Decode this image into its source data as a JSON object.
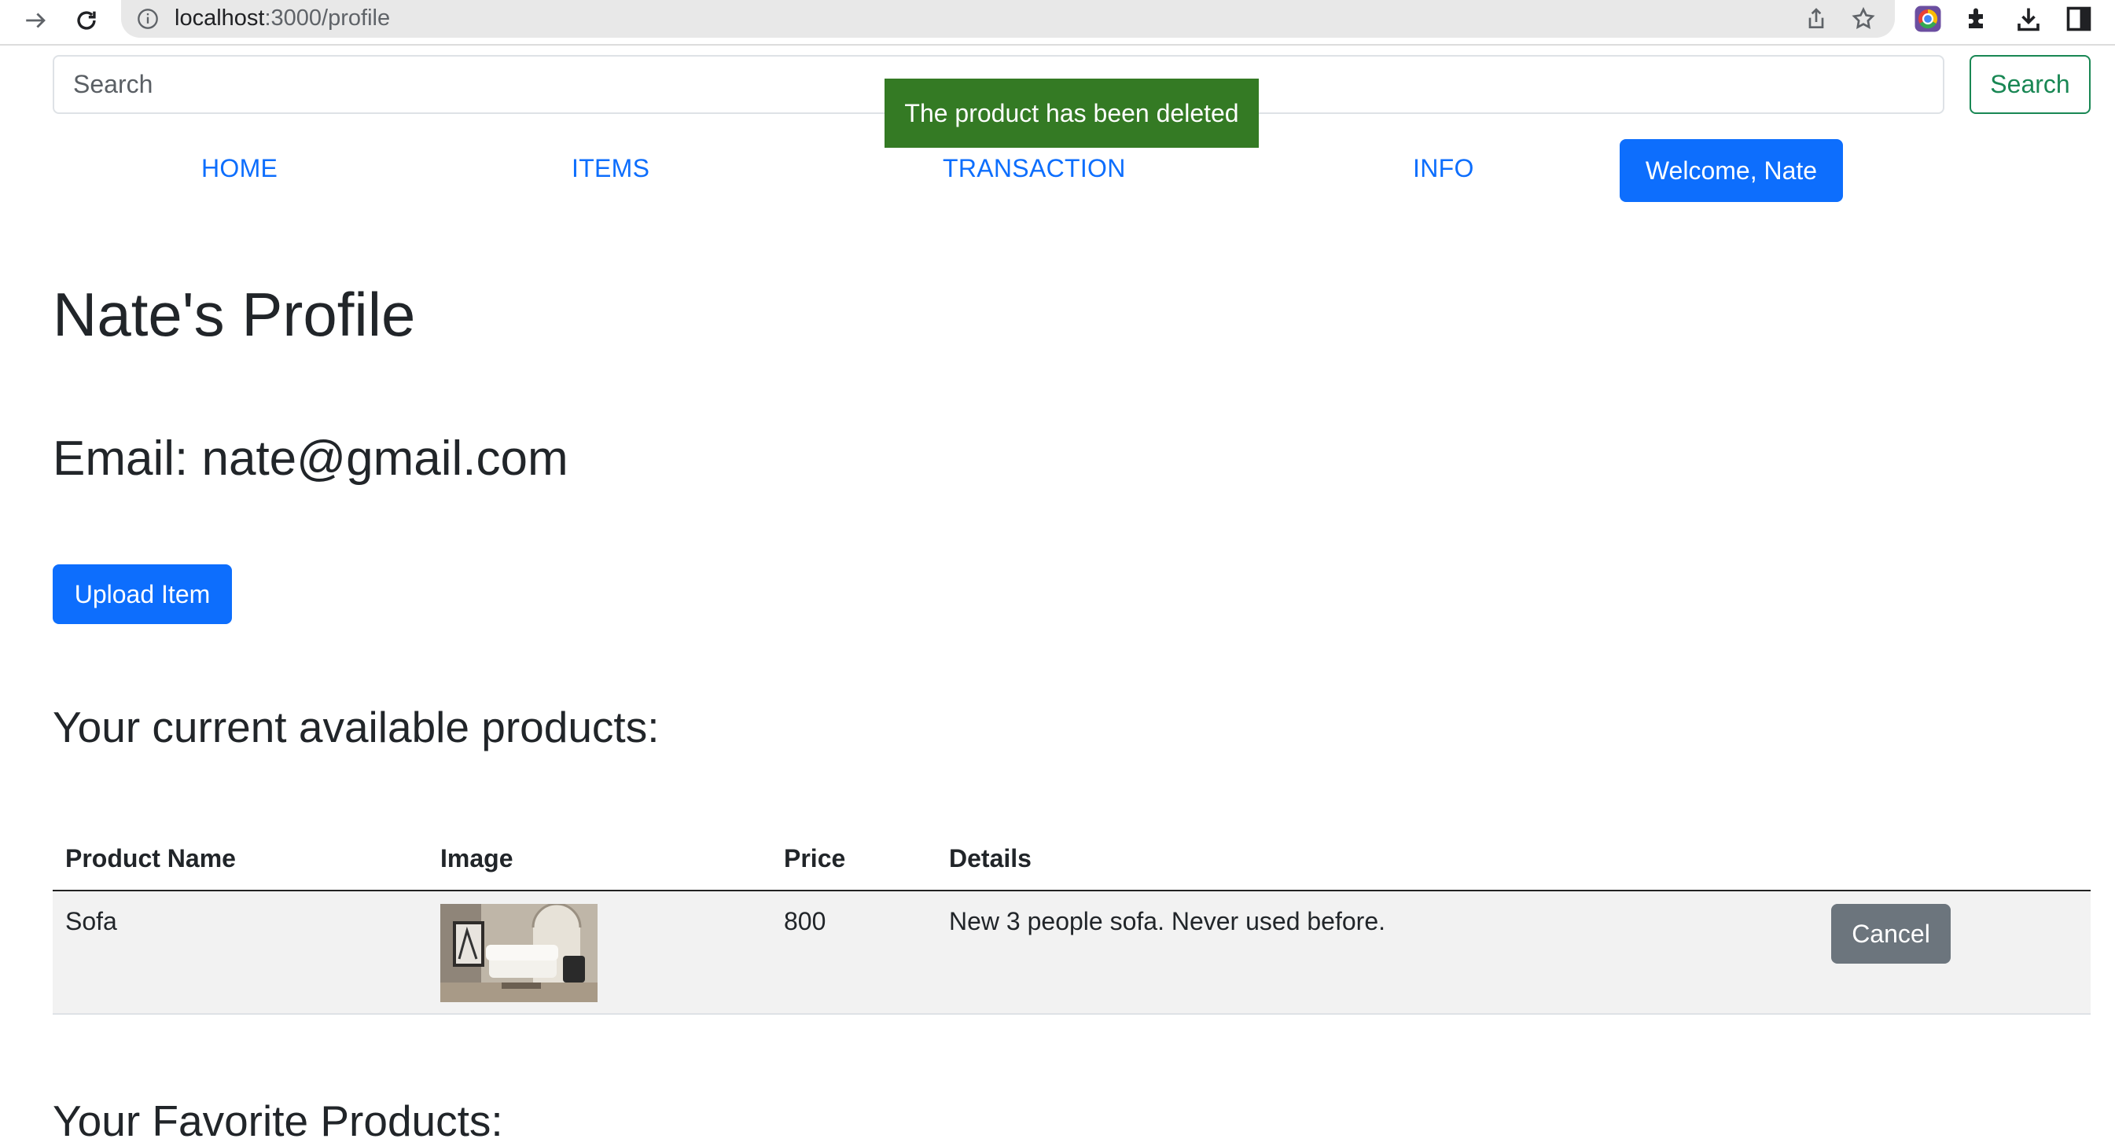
{
  "browser": {
    "url_host": "localhost",
    "url_path": ":3000/profile",
    "icons": [
      "back-arrow-icon",
      "reload-icon",
      "info-icon",
      "share-icon",
      "star-icon",
      "chrome-profile-icon",
      "extensions-icon",
      "download-icon",
      "sidebar-icon"
    ]
  },
  "search": {
    "placeholder": "Search",
    "button_label": "Search"
  },
  "toast": {
    "message": "The product has been deleted"
  },
  "nav": {
    "home": "HOME",
    "items": "ITEMS",
    "transaction": "TRANSACTION",
    "info": "INFO",
    "welcome": "Welcome, Nate"
  },
  "profile": {
    "title": "Nate's Profile",
    "email": "Email: nate@gmail.com",
    "upload_label": "Upload Item"
  },
  "products": {
    "heading": "Your current available products:",
    "columns": [
      "Product Name",
      "Image",
      "Price",
      "Details"
    ],
    "rows": [
      {
        "name": "Sofa",
        "price": "800",
        "details": "New 3 people sofa. Never used before.",
        "action": "Cancel"
      }
    ]
  },
  "favorites": {
    "heading": "Your Favorite Products:"
  },
  "colors": {
    "primary": "#0d6efd",
    "success": "#198754",
    "toast": "#347a24",
    "secondary": "#6c757d"
  }
}
